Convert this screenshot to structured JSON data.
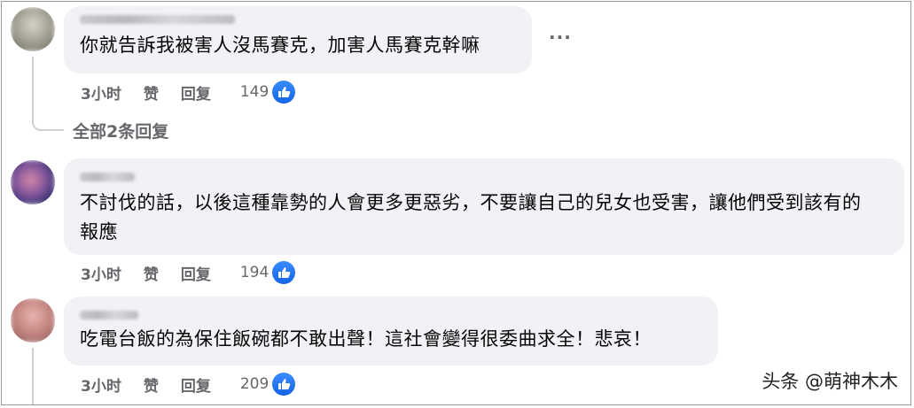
{
  "comments": [
    {
      "text": "你就告訴我被害人沒馬賽克，加害人馬賽克幹嘛",
      "time": "3小时",
      "like_label": "赞",
      "reply_label": "回复",
      "reaction_count": "149"
    },
    {
      "text": "不討伐的話，以後這種靠勢的人會更多更惡劣，不要讓自己的兒女也受害，讓他們受到該有的報應",
      "time": "3小时",
      "like_label": "赞",
      "reply_label": "回复",
      "reaction_count": "194"
    },
    {
      "text": "吃電台飯的為保住飯碗都不敢出聲！這社會變得很委曲求全！悲哀！",
      "time": "3小时",
      "like_label": "赞",
      "reply_label": "回复",
      "reaction_count": "209"
    }
  ],
  "view_replies": "全部2条回复",
  "more_menu": "···",
  "watermark": "头条 @萌神木木",
  "colors": {
    "bubble": "#f0f2f5",
    "action_text": "#65676b",
    "like_badge": "#1877f2"
  },
  "icons": [
    "thumbs-up-icon",
    "more-dots-icon",
    "avatar"
  ]
}
